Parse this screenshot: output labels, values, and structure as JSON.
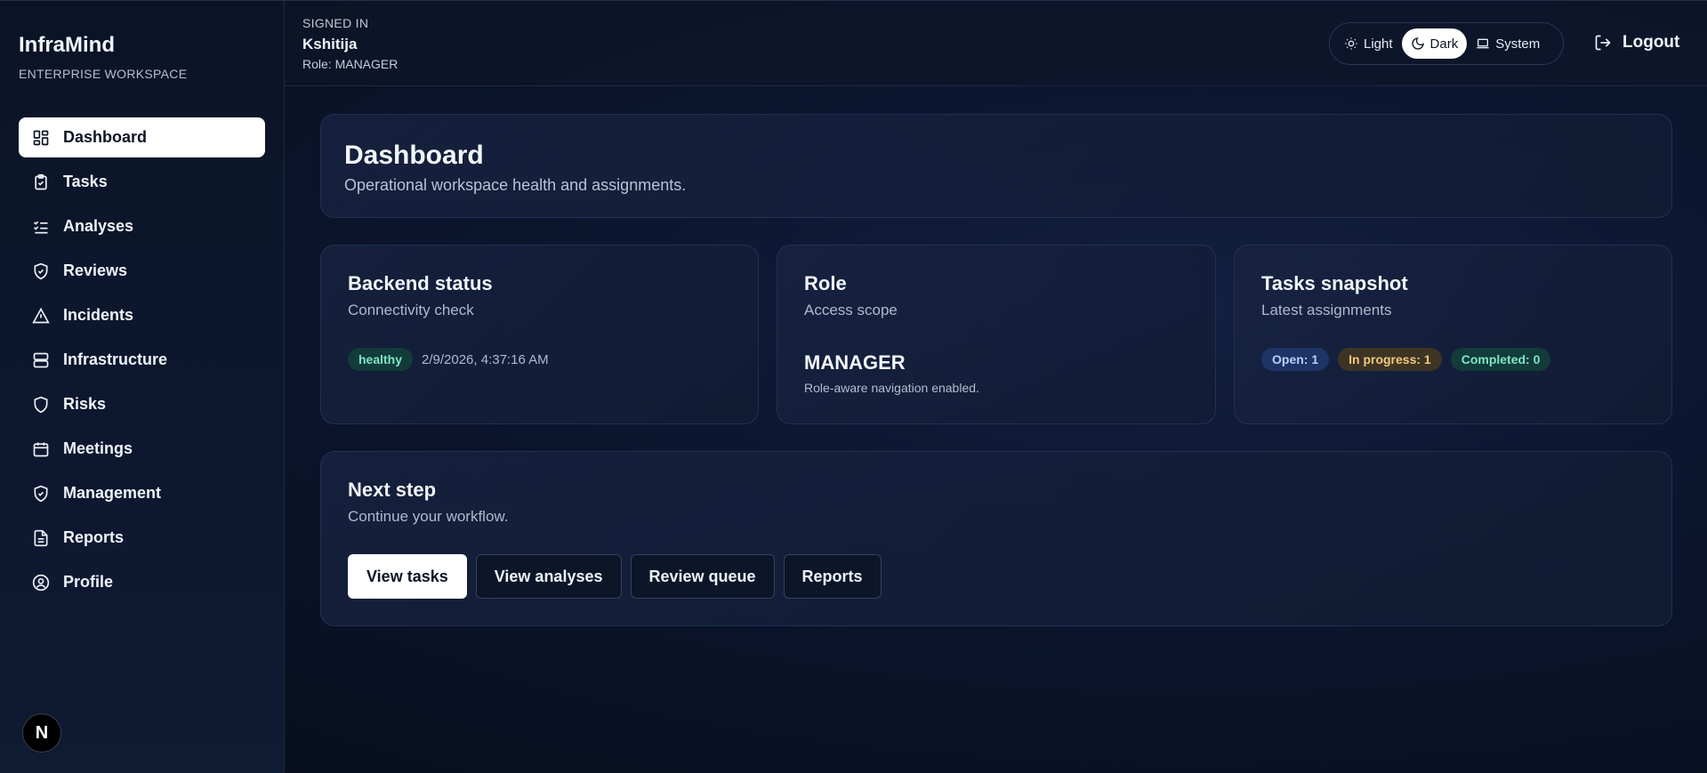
{
  "brand": {
    "name": "InfraMind",
    "subtitle": "ENTERPRISE WORKSPACE"
  },
  "sidebar": {
    "items": [
      {
        "label": "Dashboard",
        "icon": "dashboard-icon",
        "active": true
      },
      {
        "label": "Tasks",
        "icon": "clipboard-icon"
      },
      {
        "label": "Analyses",
        "icon": "checklist-icon"
      },
      {
        "label": "Reviews",
        "icon": "shield-check-icon"
      },
      {
        "label": "Incidents",
        "icon": "alert-triangle-icon"
      },
      {
        "label": "Infrastructure",
        "icon": "server-icon"
      },
      {
        "label": "Risks",
        "icon": "shield-icon"
      },
      {
        "label": "Meetings",
        "icon": "calendar-icon"
      },
      {
        "label": "Management",
        "icon": "shield-check-icon"
      },
      {
        "label": "Reports",
        "icon": "file-text-icon"
      },
      {
        "label": "Profile",
        "icon": "user-circle-icon"
      }
    ],
    "badge": "N"
  },
  "header": {
    "signed_in_label": "SIGNED IN",
    "user_name": "Kshitija",
    "role_line": "Role: MANAGER",
    "theme": {
      "light": "Light",
      "dark": "Dark",
      "system": "System",
      "selected": "Dark"
    },
    "logout": "Logout"
  },
  "hero": {
    "title": "Dashboard",
    "subtitle": "Operational workspace health and assignments."
  },
  "backend": {
    "title": "Backend status",
    "subtitle": "Connectivity check",
    "status": "healthy",
    "timestamp": "2/9/2026, 4:37:16 AM"
  },
  "role": {
    "title": "Role",
    "subtitle": "Access scope",
    "value": "MANAGER",
    "note": "Role-aware navigation enabled."
  },
  "tasks": {
    "title": "Tasks snapshot",
    "subtitle": "Latest assignments",
    "open": "Open: 1",
    "in_progress": "In progress: 1",
    "completed": "Completed: 0"
  },
  "next_step": {
    "title": "Next step",
    "subtitle": "Continue your workflow.",
    "buttons": [
      "View tasks",
      "View analyses",
      "Review queue",
      "Reports"
    ]
  },
  "colors": {
    "accent": "#ffffff",
    "healthy": "#7ee6c4",
    "open": "#b9cff7",
    "in_progress": "#f5c97a",
    "completed": "#7ee6c4"
  }
}
